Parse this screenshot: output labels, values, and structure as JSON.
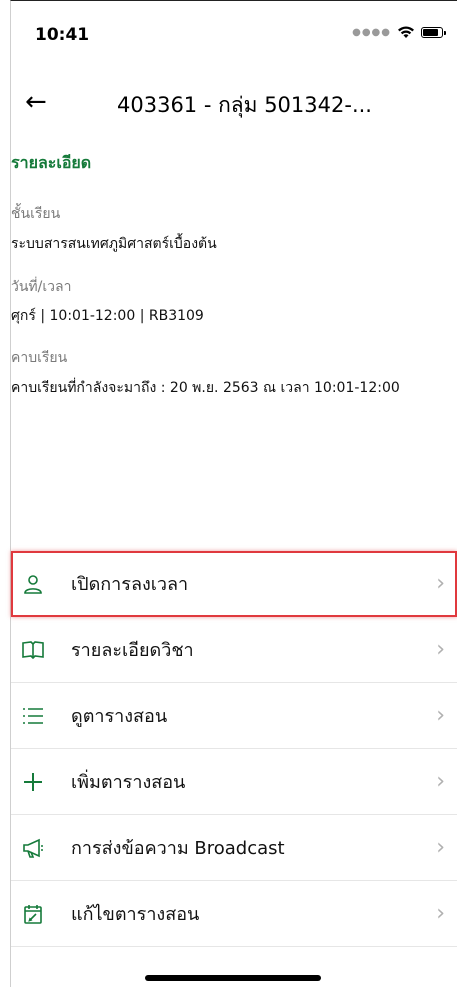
{
  "status_bar": {
    "time": "10:41"
  },
  "header": {
    "title": "403361 - กลุ่ม 501342-..."
  },
  "details": {
    "section_title": "รายละเอียด",
    "class_label": "ชั้นเรียน",
    "class_value": "ระบบสารสนเทศภูมิศาสตร์เบื้องต้น",
    "datetime_label": "วันที่/เวลา",
    "datetime_value": "ศุกร์  |  10:01-12:00  |  RB3109",
    "period_label": "คาบเรียน",
    "period_value": "คาบเรียนที่กำลังจะมาถึง : 20 พ.ย. 2563 ณ เวลา 10:01-12:00"
  },
  "menu": [
    {
      "label": "เปิดการลงเวลา",
      "icon": "person-icon"
    },
    {
      "label": "รายละเอียดวิชา",
      "icon": "book-icon"
    },
    {
      "label": "ดูตารางสอน",
      "icon": "list-icon"
    },
    {
      "label": "เพิ่มตารางสอน",
      "icon": "plus-icon"
    },
    {
      "label": "การส่งข้อความ Broadcast",
      "icon": "megaphone-icon"
    },
    {
      "label": "แก้ไขตารางสอน",
      "icon": "calendar-edit-icon"
    }
  ],
  "colors": {
    "accent": "#157a3a",
    "highlight": "#e0393e"
  }
}
